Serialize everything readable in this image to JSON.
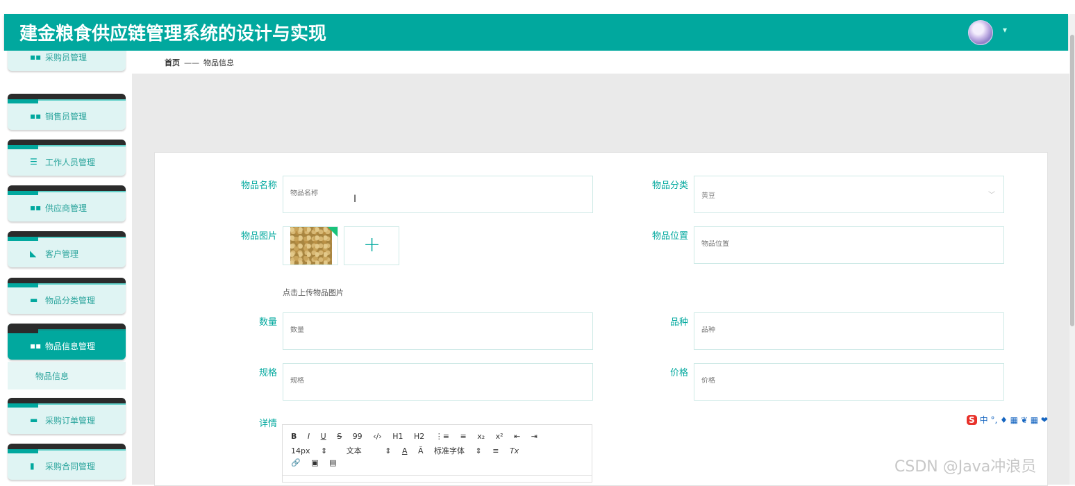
{
  "app": {
    "title": "建金粮食供应链管理系统的设计与实现",
    "caret": "▾"
  },
  "sidebar": {
    "items": [
      {
        "label": "采购员管理",
        "icon": "grid-icon",
        "glyph": "▪▪"
      },
      {
        "label": "销售员管理",
        "icon": "grid-icon",
        "glyph": "▪▪"
      },
      {
        "label": "工作人员管理",
        "icon": "sliders-icon",
        "glyph": "☰"
      },
      {
        "label": "供应商管理",
        "icon": "grid-icon",
        "glyph": "▪▪"
      },
      {
        "label": "客户管理",
        "icon": "thumb-icon",
        "glyph": "◣"
      },
      {
        "label": "物品分类管理",
        "icon": "briefcase-icon",
        "glyph": "▬"
      },
      {
        "label": "物品信息管理",
        "icon": "grid-icon",
        "glyph": "▪▪"
      },
      {
        "label": "采购订单管理",
        "icon": "ticket-icon",
        "glyph": "▬"
      },
      {
        "label": "采购合同管理",
        "icon": "document-icon",
        "glyph": "▮"
      }
    ],
    "submenu_label": "物品信息"
  },
  "breadcrumb": {
    "home": "首页",
    "separator": "——",
    "current": "物品信息"
  },
  "form": {
    "name_label": "物品名称",
    "name_placeholder": "物品名称",
    "category_label": "物品分类",
    "category_value": "黄豆",
    "image_label": "物品图片",
    "image_hint": "点击上传物品图片",
    "add_glyph": "+",
    "location_label": "物品位置",
    "location_placeholder": "物品位置",
    "quantity_label": "数量",
    "quantity_placeholder": "数量",
    "variety_label": "品种",
    "variety_placeholder": "品种",
    "spec_label": "规格",
    "spec_placeholder": "规格",
    "price_label": "价格",
    "price_placeholder": "价格",
    "detail_label": "详情"
  },
  "editor": {
    "row1": [
      "B",
      "I",
      "U",
      "S",
      "99",
      "‹/›",
      "H1",
      "H2",
      "⋮≡",
      "≡",
      "x₂",
      "x²",
      "⇤",
      "⇥"
    ],
    "row2": [
      "14px",
      "⇕",
      "文本",
      "⇕",
      "A",
      "Ă",
      "标准字体",
      "⇕",
      "≡",
      "Tx"
    ],
    "row3": [
      "🔗",
      "▣",
      "▤"
    ]
  },
  "ime": {
    "brand": "S",
    "items": "中 °, ♦ ▦ ❦ ▦ ❤"
  },
  "watermark": "CSDN @Java冲浪员",
  "colors": {
    "primary": "#01a89e",
    "sidebar_bg": "#dff4f3"
  }
}
